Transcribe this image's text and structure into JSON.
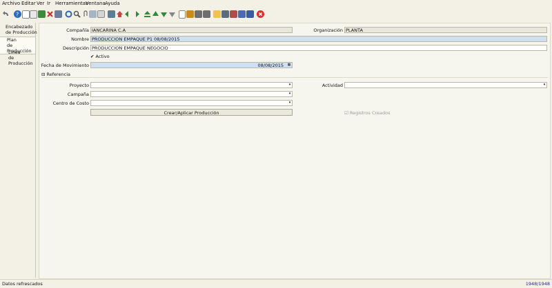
{
  "menu": [
    "Archivo",
    "Editar",
    "Ver",
    "Ir",
    "Herramientas",
    "Ventana",
    "Ayuda"
  ],
  "colors": {
    "accent": "#cfe0f2",
    "readonly": "#e9e7da",
    "statusBlue": "#1a1ab8"
  },
  "toolbar_icons": [
    "undo-icon",
    "help-icon",
    "new-icon",
    "copy-icon",
    "save-icon",
    "delete-icon",
    "find-icon",
    "refresh-icon",
    "zoom-icon",
    "attachment-icon",
    "history-icon",
    "archive-icon",
    "report-icon",
    "first-icon",
    "previous-icon",
    "next-icon",
    "last-icon",
    "parent-icon",
    "detail-icon",
    "multi-icon",
    "print-icon",
    "lock-icon",
    "chat-icon",
    "request-icon",
    "product-icon",
    "exit-icon"
  ],
  "sidebar": {
    "tabs": [
      {
        "label_line1": "Encabezado",
        "label_line2": "de Producción"
      },
      {
        "label_line1": "Plan",
        "label_line2": "de Producción"
      },
      {
        "label_line1": "Línea",
        "label_line2": "de Producción"
      }
    ]
  },
  "form": {
    "company_label": "Compañía",
    "company_value": "IANCARINA C.A",
    "org_label": "Organización",
    "org_value": "PLANTA",
    "name_label": "Nombre",
    "name_value": "PRODUCCION  EMPAQUE  P1  08/08/2015",
    "desc_label": "Descripción",
    "desc_value": "PRODUCCION EMPAQUE   NEGOCIO",
    "active_label": "Activo",
    "date_label": "Fecha de Movimiento",
    "date_value": "08/08/2015",
    "reference_label": "Referencia",
    "project_label": "Proyecto",
    "project_value": "",
    "activity_label": "Actividad",
    "activity_value": "",
    "campaign_label": "Campaña",
    "campaign_value": "",
    "cost_center_label": "Centro de Costo",
    "cost_center_value": "",
    "button_label": "Crear/Aplicar Producción",
    "records_label": "Registros Creados"
  },
  "status": {
    "message": "Datos refrescados",
    "record": "1948/1948"
  }
}
